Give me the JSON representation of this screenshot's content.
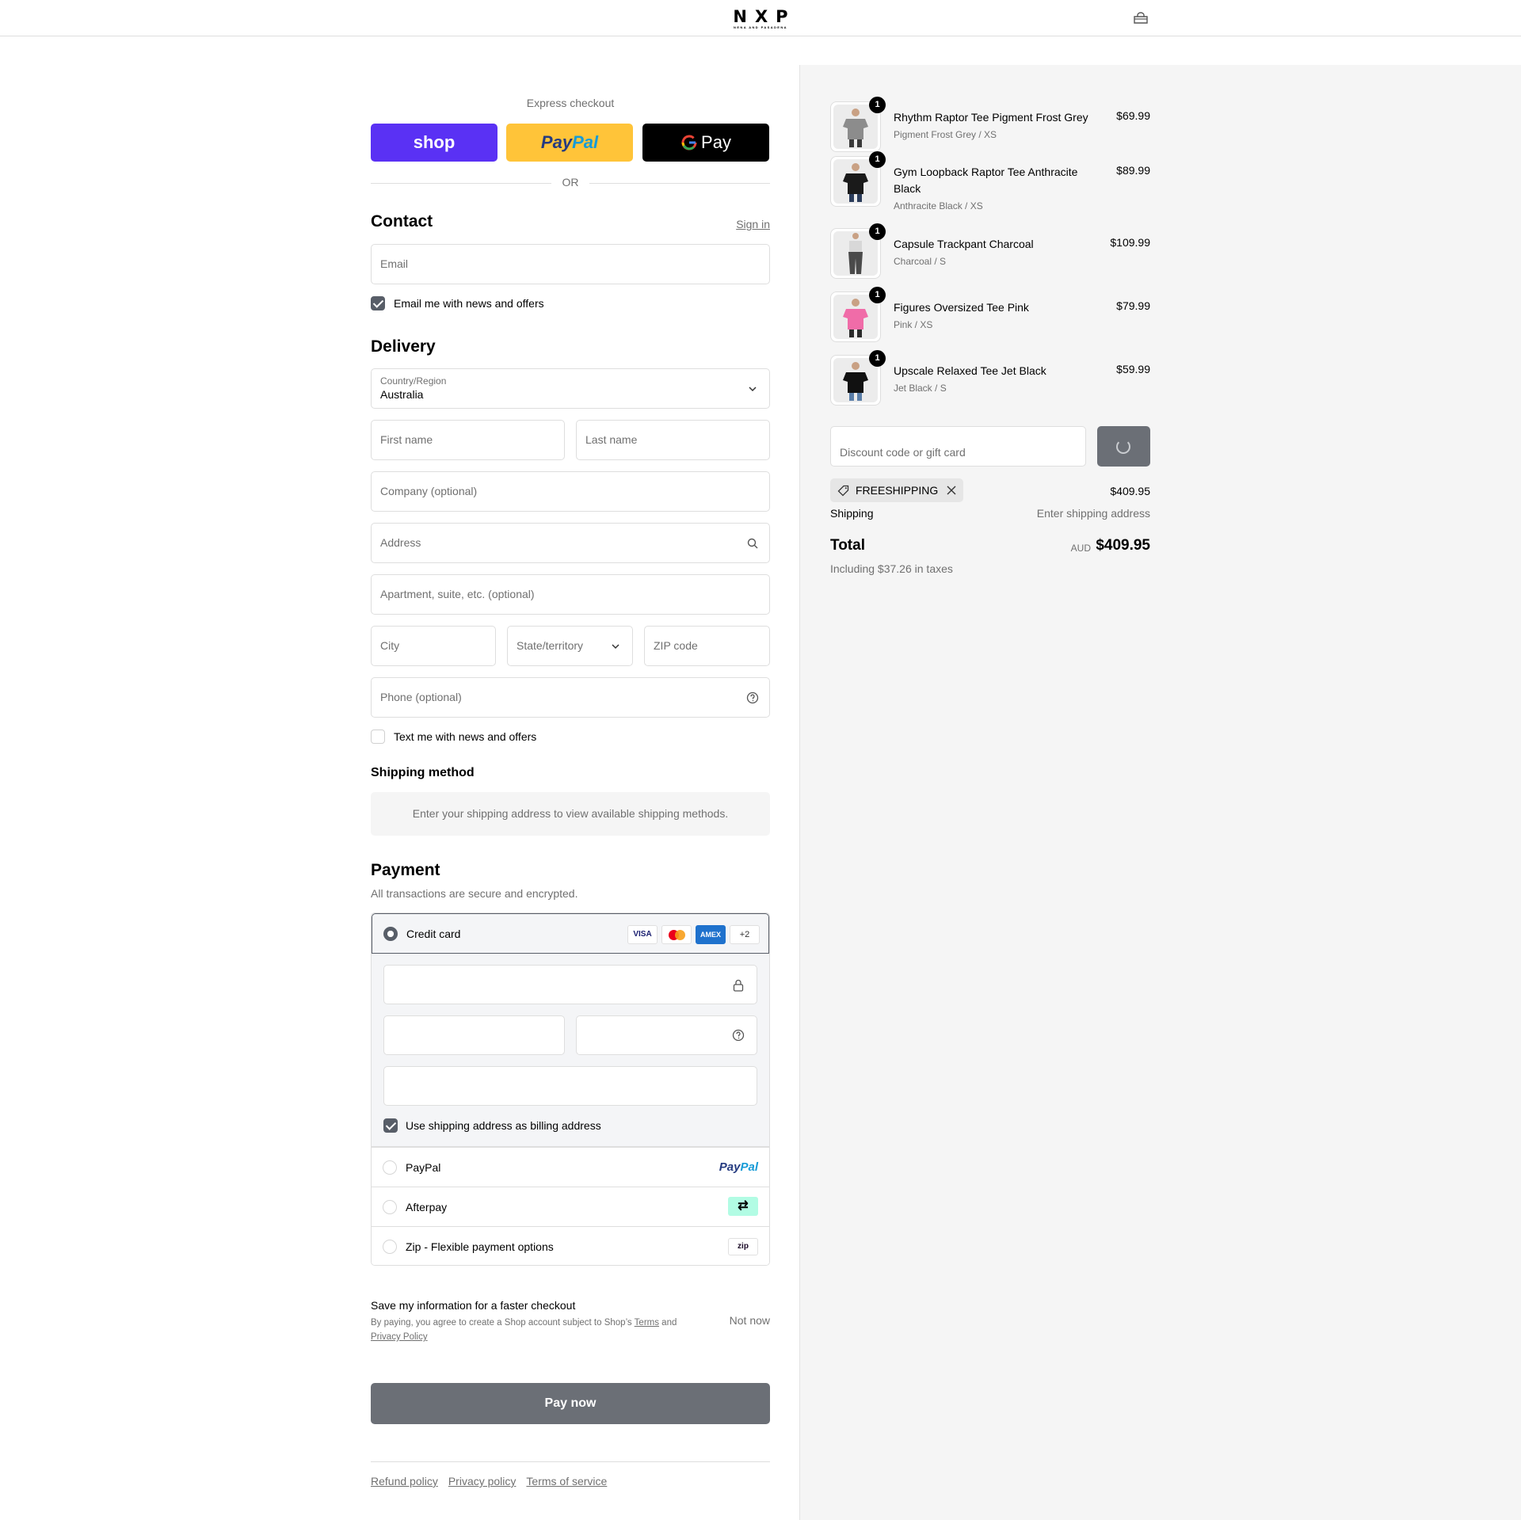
{
  "header": {
    "logo_text": "NXP",
    "logo_subtext": "NENA AND PASADENA",
    "cart_icon": "bag-icon"
  },
  "express": {
    "title": "Express checkout",
    "shop_label": "shop",
    "paypal_label_1": "Pay",
    "paypal_label_2": "Pal",
    "gpay_label": "Pay",
    "or_label": "OR"
  },
  "contact": {
    "title": "Contact",
    "sign_in": "Sign in",
    "email_placeholder": "Email",
    "email_news_label": "Email me with news and offers",
    "email_news_checked": true
  },
  "delivery": {
    "title": "Delivery",
    "country_label": "Country/Region",
    "country_value": "Australia",
    "first_name": "First name",
    "last_name": "Last name",
    "company": "Company (optional)",
    "address": "Address",
    "apartment": "Apartment, suite, etc. (optional)",
    "city": "City",
    "state": "State/territory",
    "zip": "ZIP code",
    "phone": "Phone (optional)",
    "text_news_label": "Text me with news and offers",
    "text_news_checked": false
  },
  "shipping_method": {
    "title": "Shipping method",
    "message": "Enter your shipping address to view available shipping methods."
  },
  "payment": {
    "title": "Payment",
    "subtitle": "All transactions are secure and encrypted.",
    "credit_card_label": "Credit card",
    "brands": [
      "VISA",
      "AMEX",
      "+2"
    ],
    "billing_label": "Use shipping address as billing address",
    "billing_checked": true,
    "paypal_label": "PayPal",
    "paypal_logo_1": "Pay",
    "paypal_logo_2": "Pal",
    "afterpay_label": "Afterpay",
    "zip_label": "Zip - Flexible payment options",
    "zip_logo": "zip"
  },
  "save_info": {
    "title": "Save my information for a faster checkout",
    "sub_1": "By paying, you agree to create a Shop account subject to Shop’s ",
    "terms": "Terms",
    "sub_2": " and ",
    "privacy": "Privacy Policy",
    "not_now": "Not now"
  },
  "pay_now": "Pay now",
  "footer": {
    "links": [
      "Refund policy",
      "Privacy policy",
      "Terms of service"
    ]
  },
  "summary": {
    "items": [
      {
        "name": "Rhythm Raptor Tee Pigment Frost Grey",
        "variant": "Pigment Frost Grey / XS",
        "price": "$69.99",
        "qty": "1",
        "color": "#8c8c8c"
      },
      {
        "name": "Gym Loopback Raptor Tee Anthracite Black",
        "variant": "Anthracite Black / XS",
        "price": "$89.99",
        "qty": "1",
        "color": "#1a1a1a"
      },
      {
        "name": "Capsule Trackpant Charcoal",
        "variant": "Charcoal / S",
        "price": "$109.99",
        "qty": "1",
        "color": "#4a4a4a"
      },
      {
        "name": "Figures Oversized Tee Pink",
        "variant": "Pink / XS",
        "price": "$79.99",
        "qty": "1",
        "color": "#f06ca8"
      },
      {
        "name": "Upscale Relaxed Tee Jet Black",
        "variant": "Jet Black / S",
        "price": "$59.99",
        "qty": "1",
        "color": "#111111"
      }
    ],
    "discount_placeholder": "Discount code or gift card",
    "discount_code": "FREESHIPPING",
    "subtotal": "$409.95",
    "shipping_label": "Shipping",
    "shipping_value": "Enter shipping address",
    "total_label": "Total",
    "currency": "AUD",
    "total_value": "$409.95",
    "tax_note": "Including $37.26 in taxes"
  }
}
